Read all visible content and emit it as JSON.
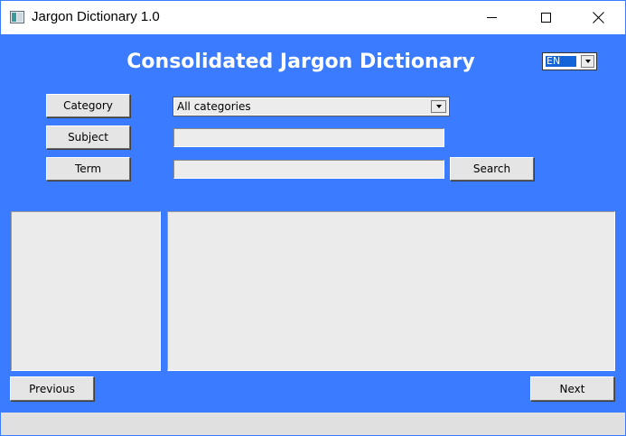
{
  "window": {
    "title": "Jargon Dictionary 1.0"
  },
  "header": {
    "title": "Consolidated Jargon Dictionary",
    "language": {
      "selected": "EN"
    }
  },
  "search": {
    "category_button": "Category",
    "subject_button": "Subject",
    "term_button": "Term",
    "category_selected": "All categories",
    "subject_value": "",
    "term_value": "",
    "search_button": "Search"
  },
  "navigation": {
    "previous": "Previous",
    "next": "Next"
  },
  "status": {
    "text": ""
  }
}
